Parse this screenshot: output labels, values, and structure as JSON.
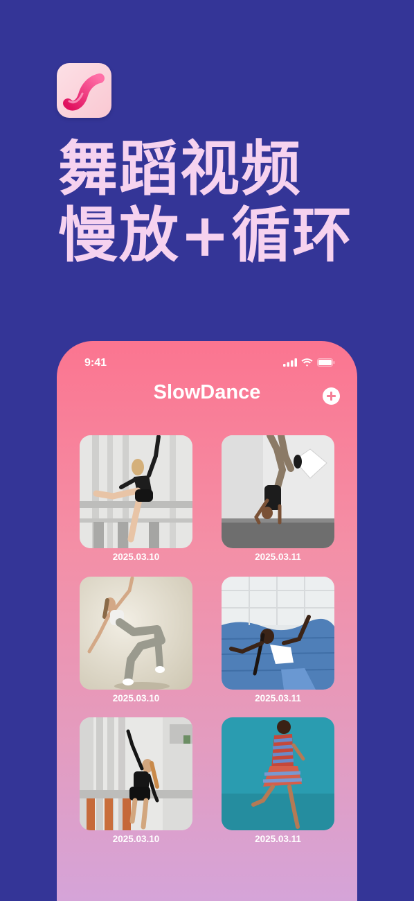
{
  "headline": {
    "line1": "舞蹈视频",
    "line2": "慢放+循环"
  },
  "status_bar": {
    "time": "9:41"
  },
  "app": {
    "title": "SlowDance"
  },
  "videos": [
    {
      "date": "2025.03.10"
    },
    {
      "date": "2025.03.11"
    },
    {
      "date": "2025.03.10"
    },
    {
      "date": "2025.03.11"
    },
    {
      "date": "2025.03.10"
    },
    {
      "date": "2025.03.11"
    }
  ],
  "colors": {
    "background": "#343597",
    "headline": "#f6d2ef",
    "phone_gradient_top": "#fb7590",
    "phone_gradient_bottom": "#d3a5dc"
  }
}
